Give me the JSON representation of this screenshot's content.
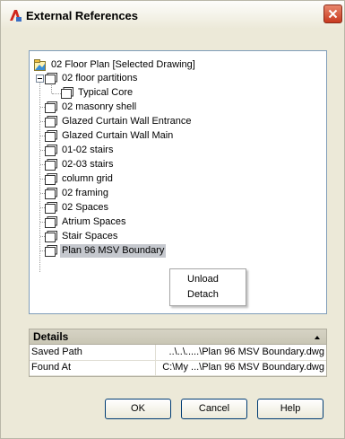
{
  "window": {
    "title": "External References"
  },
  "tree": {
    "root": "02 Floor Plan [Selected Drawing]",
    "items": [
      {
        "label": "02 floor partitions"
      },
      {
        "label": "Typical Core"
      },
      {
        "label": "02 masonry shell"
      },
      {
        "label": "Glazed Curtain Wall Entrance"
      },
      {
        "label": "Glazed Curtain Wall Main"
      },
      {
        "label": "01-02 stairs"
      },
      {
        "label": "02-03 stairs"
      },
      {
        "label": "column grid"
      },
      {
        "label": "02 framing"
      },
      {
        "label": "02 Spaces"
      },
      {
        "label": "Atrium Spaces"
      },
      {
        "label": "Stair Spaces"
      },
      {
        "label": "Plan 96 MSV Boundary"
      }
    ]
  },
  "context_menu": {
    "unload": "Unload",
    "detach": "Detach"
  },
  "details": {
    "header": "Details",
    "rows": [
      {
        "key": "Saved Path",
        "value": "..\\..\\.....\\Plan 96 MSV Boundary.dwg"
      },
      {
        "key": "Found At",
        "value": "C:\\My ...\\Plan 96 MSV Boundary.dwg"
      }
    ]
  },
  "buttons": {
    "ok": "OK",
    "cancel": "Cancel",
    "help": "Help"
  }
}
